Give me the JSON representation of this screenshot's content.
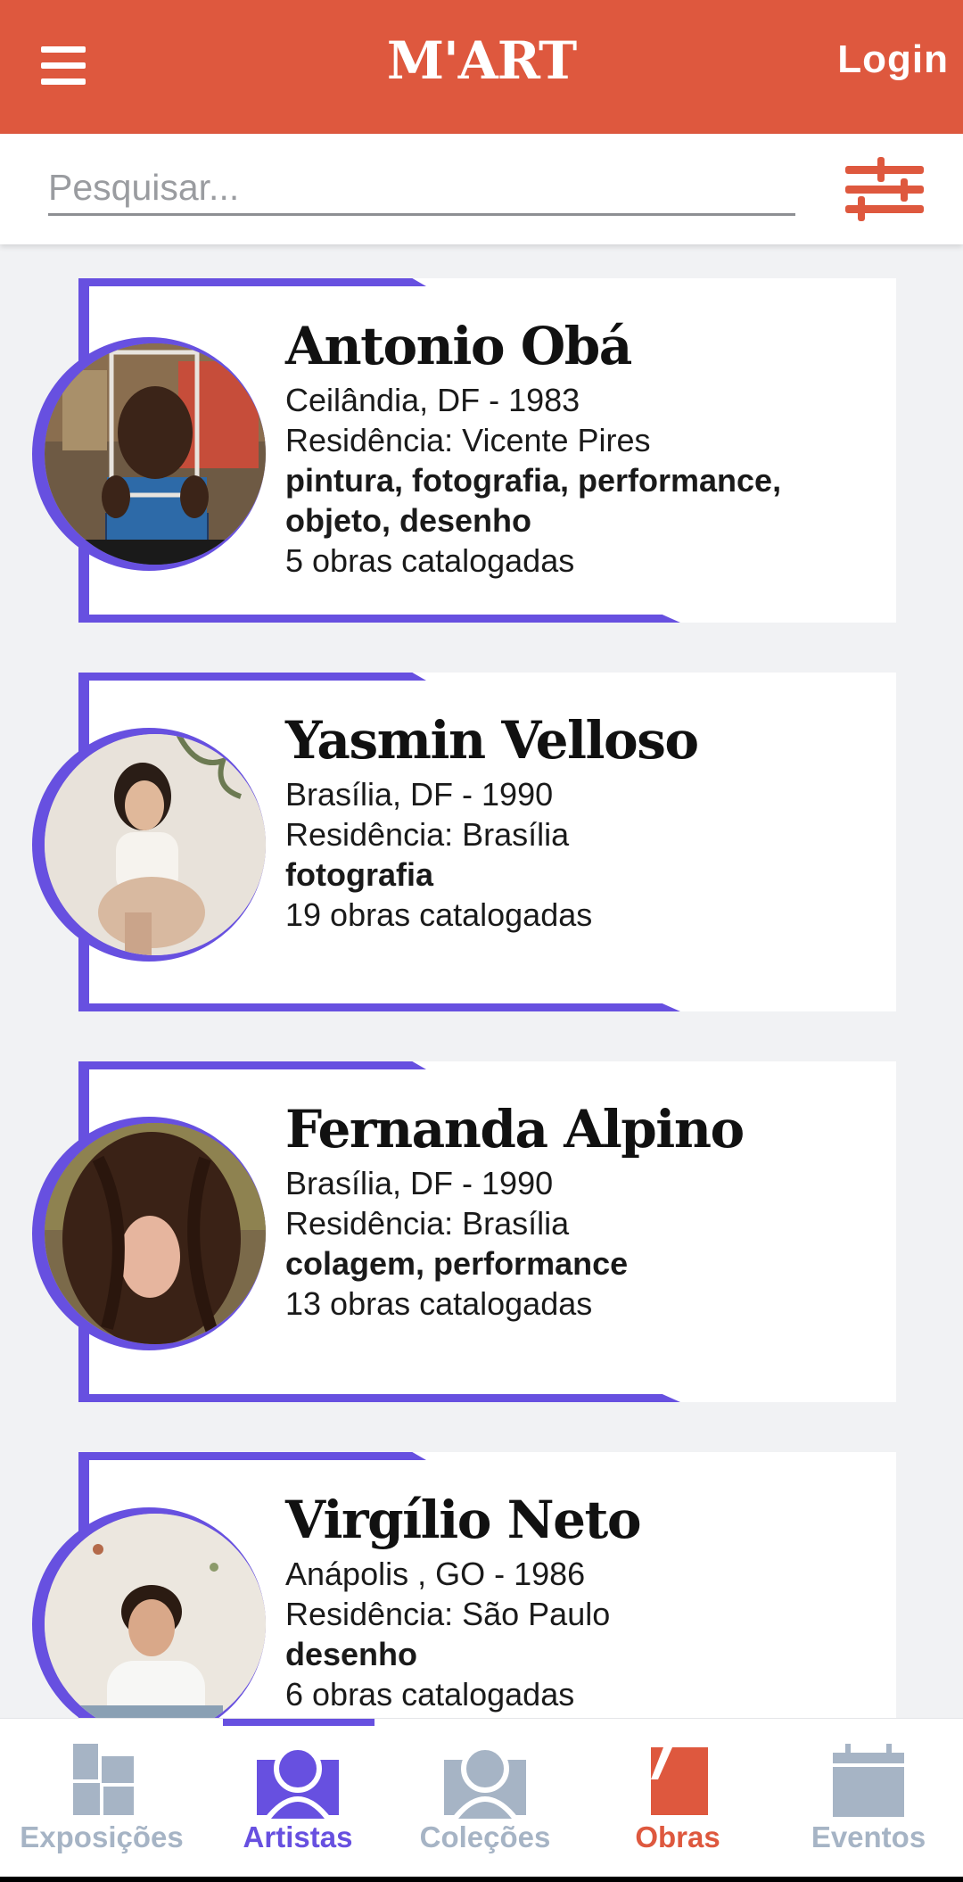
{
  "header": {
    "logo": "M'ART",
    "login_label": "Login"
  },
  "search": {
    "placeholder": "Pesquisar...",
    "value": ""
  },
  "artists": [
    {
      "name": "Antonio Obá",
      "origin": "Ceilândia, DF - 1983",
      "residence": "Residência: Vicente Pires",
      "media_line1": "pintura, fotografia, performance,",
      "media_line2": "objeto, desenho",
      "works": "5 obras catalogadas"
    },
    {
      "name": "Yasmin Velloso",
      "origin": "Brasília, DF - 1990",
      "residence": "Residência: Brasília",
      "media_line1": "fotografia",
      "works": "19 obras catalogadas"
    },
    {
      "name": "Fernanda Alpino",
      "origin": "Brasília, DF - 1990",
      "residence": "Residência: Brasília",
      "media_line1": "colagem, performance",
      "works": "13 obras catalogadas"
    },
    {
      "name": "Virgílio Neto",
      "origin": "Anápolis , GO - 1986",
      "residence": "Residência: São Paulo",
      "media_line1": "desenho",
      "works": "6 obras catalogadas"
    }
  ],
  "nav": [
    {
      "label": "Exposições",
      "icon": "grid-icon",
      "color": "#a6b4c5"
    },
    {
      "label": "Artistas",
      "icon": "person-icon",
      "color": "#6750e0",
      "active": true
    },
    {
      "label": "Coleções",
      "icon": "person-icon",
      "color": "#a6b4c5"
    },
    {
      "label": "Obras",
      "icon": "canvas-icon",
      "color": "#de583e"
    },
    {
      "label": "Eventos",
      "icon": "calendar-icon",
      "color": "#a6b4c5"
    }
  ],
  "colors": {
    "brand": "#de583e",
    "accent": "#6750e0",
    "nav_inactive": "#a6b4c5"
  }
}
